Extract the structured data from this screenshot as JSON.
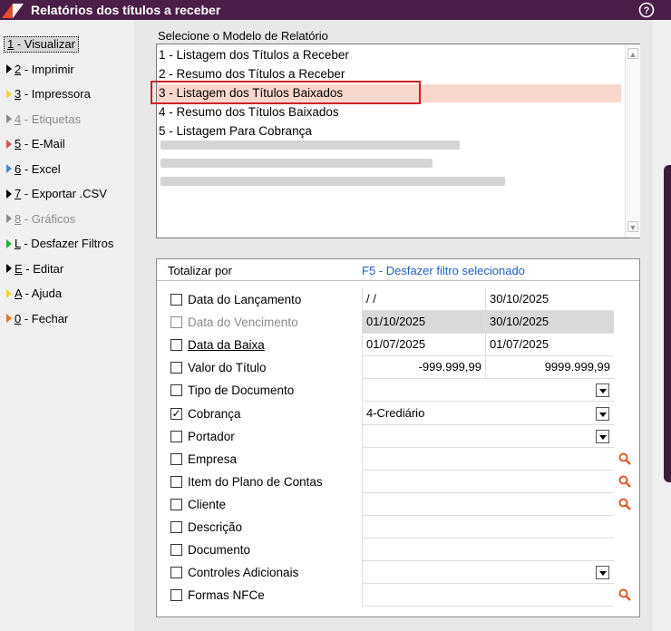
{
  "window": {
    "title": "Relatórios dos títulos a receber"
  },
  "colors": {
    "titlebar": "#4a1e47",
    "selection": "#f9d7cd",
    "highlight_border": "#d0202a",
    "link": "#1f5fbf",
    "search_icon": "#e0592a"
  },
  "sidebar": {
    "items": [
      {
        "key": "1",
        "label": " - Visualizar",
        "selected": true,
        "icon": "none"
      },
      {
        "key": "2",
        "label": " - Imprimir",
        "icon": "arrow-black"
      },
      {
        "key": "3",
        "label": " - Impressora",
        "icon": "arrow-yellow"
      },
      {
        "key": "4",
        "label": " - Etiquetas",
        "icon": "arrow-gray",
        "disabled": true
      },
      {
        "key": "5",
        "label": " - E-Mail",
        "icon": "arrow-red"
      },
      {
        "key": "6",
        "label": " - Excel",
        "icon": "arrow-blue"
      },
      {
        "key": "7",
        "label": " - Exportar .CSV",
        "icon": "arrow-black"
      },
      {
        "key": "8",
        "label": " - Gráficos",
        "icon": "arrow-gray",
        "disabled": true
      },
      {
        "key": "L",
        "label": " - Desfazer Filtros",
        "icon": "arrow-green"
      },
      {
        "key": "E",
        "label": " - Editar",
        "icon": "arrow-black"
      },
      {
        "key": "A",
        "label": " - Ajuda",
        "icon": "arrow-yellow"
      },
      {
        "key": "0",
        "label": " - Fechar",
        "icon": "arrow-orange"
      }
    ]
  },
  "report_model": {
    "label": "Selecione o Modelo de Relatório",
    "items": [
      "1 - Listagem dos Títulos a Receber",
      "2 - Resumo dos Títulos a Receber",
      "3 - Listagem dos Títulos Baixados",
      "4 - Resumo dos Títulos Baixados",
      "5 - Listagem Para Cobrança"
    ],
    "selected_index": 2
  },
  "filters": {
    "totalizar_label": "Totalizar por",
    "undo_link": "F5 - Desfazer filtro selecionado",
    "rows": [
      {
        "label": "Data do Lançamento",
        "checked": false,
        "from": " / /",
        "to": "30/10/2025"
      },
      {
        "label": "Data do Vencimento",
        "checked": false,
        "disabled": true,
        "from": "01/10/2025",
        "to": "30/10/2025"
      },
      {
        "label": "Data da Baixa",
        "checked": false,
        "underline": true,
        "from": "01/07/2025",
        "to": "01/07/2025"
      },
      {
        "label": "Valor do Título",
        "checked": false,
        "from": "-999.999,99",
        "to": "9999.999,99"
      },
      {
        "label": "Tipo de Documento",
        "checked": false,
        "value": "",
        "dropdown": true
      },
      {
        "label": "Cobrança",
        "checked": true,
        "value": "4-Crediário",
        "dropdown": true
      },
      {
        "label": "Portador",
        "checked": false,
        "value": "",
        "dropdown": true
      },
      {
        "label": "Empresa",
        "checked": false,
        "value": "",
        "search": true
      },
      {
        "label": "Item do Plano de Contas",
        "checked": false,
        "value": "",
        "search": true
      },
      {
        "label": "Cliente",
        "checked": false,
        "value": "",
        "search": true
      },
      {
        "label": "Descrição",
        "checked": false,
        "value": ""
      },
      {
        "label": "Documento",
        "checked": false,
        "value": ""
      },
      {
        "label": "Controles Adicionais",
        "checked": false,
        "value": "",
        "dropdown": true
      },
      {
        "label": "Formas NFCe",
        "checked": false,
        "value": "",
        "search": true
      }
    ]
  }
}
